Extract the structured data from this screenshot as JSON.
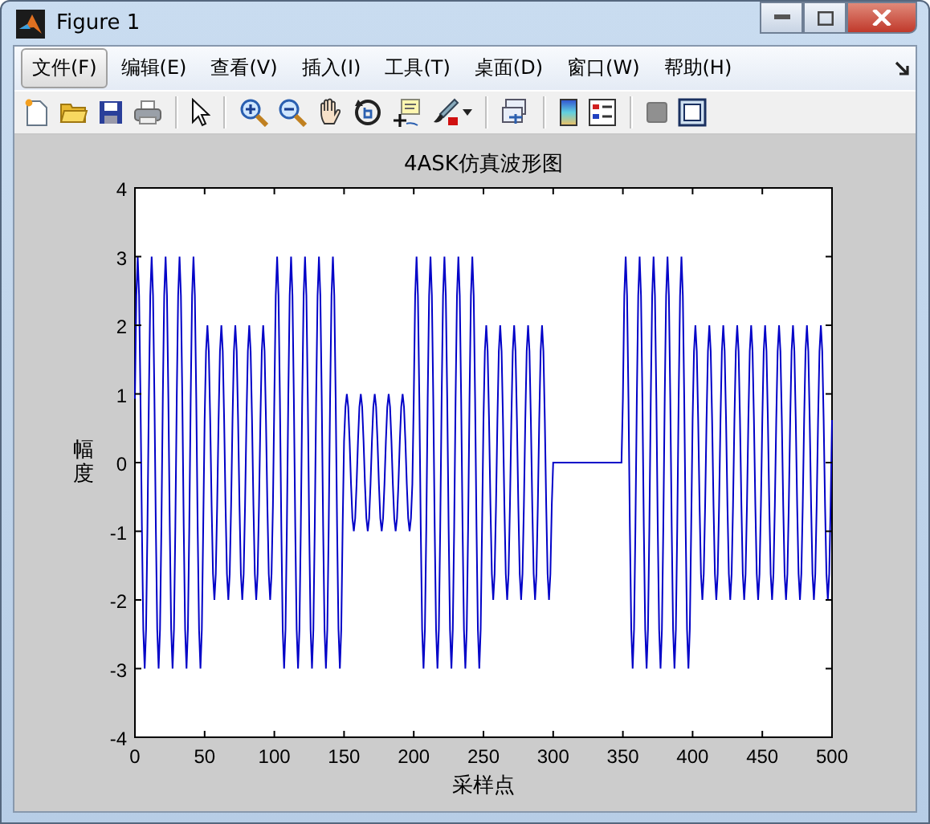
{
  "window": {
    "title": "Figure 1"
  },
  "menu": [
    {
      "label": "文件(F)",
      "selected": true
    },
    {
      "label": "编辑(E)",
      "selected": false
    },
    {
      "label": "查看(V)",
      "selected": false
    },
    {
      "label": "插入(I)",
      "selected": false
    },
    {
      "label": "工具(T)",
      "selected": false
    },
    {
      "label": "桌面(D)",
      "selected": false
    },
    {
      "label": "窗口(W)",
      "selected": false
    },
    {
      "label": "帮助(H)",
      "selected": false
    }
  ],
  "figure": {
    "chart_data": {
      "type": "line",
      "title": "4ASK仿真波形图",
      "xlabel": "采样点",
      "ylabel": "幅度",
      "xlim": [
        0,
        500
      ],
      "ylim": [
        -4,
        4
      ],
      "xticks": [
        0,
        50,
        100,
        150,
        200,
        250,
        300,
        350,
        400,
        450,
        500
      ],
      "yticks": [
        -4,
        -3,
        -2,
        -1,
        0,
        1,
        2,
        3,
        4
      ],
      "x": [
        0,
        1,
        2,
        3,
        4,
        5,
        6,
        7,
        8,
        9,
        10,
        11,
        12,
        13,
        14,
        15,
        16,
        17,
        18,
        19,
        20,
        21,
        22,
        23,
        24,
        25,
        26,
        27,
        28,
        29,
        30,
        31,
        32,
        33,
        34,
        35,
        36,
        37,
        38,
        39,
        40,
        41,
        42,
        43,
        44,
        45,
        46,
        47,
        48,
        49,
        50,
        51,
        52,
        53,
        54,
        55,
        56,
        57,
        58,
        59,
        60,
        61,
        62,
        63,
        64,
        65,
        66,
        67,
        68,
        69,
        70,
        71,
        72,
        73,
        74,
        75,
        76,
        77,
        78,
        79,
        80,
        81,
        82,
        83,
        84,
        85,
        86,
        87,
        88,
        89,
        90,
        91,
        92,
        93,
        94,
        95,
        96,
        97,
        98,
        99,
        100,
        101,
        102,
        103,
        104,
        105,
        106,
        107,
        108,
        109,
        110,
        111,
        112,
        113,
        114,
        115,
        116,
        117,
        118,
        119,
        120,
        121,
        122,
        123,
        124,
        125,
        126,
        127,
        128,
        129,
        130,
        131,
        132,
        133,
        134,
        135,
        136,
        137,
        138,
        139,
        140,
        141,
        142,
        143,
        144,
        145,
        146,
        147,
        148,
        149,
        150,
        151,
        152,
        153,
        154,
        155,
        156,
        157,
        158,
        159,
        160,
        161,
        162,
        163,
        164,
        165,
        166,
        167,
        168,
        169,
        170,
        171,
        172,
        173,
        174,
        175,
        176,
        177,
        178,
        179,
        180,
        181,
        182,
        183,
        184,
        185,
        186,
        187,
        188,
        189,
        190,
        191,
        192,
        193,
        194,
        195,
        196,
        197,
        198,
        199,
        200,
        201,
        202,
        203,
        204,
        205,
        206,
        207,
        208,
        209,
        210,
        211,
        212,
        213,
        214,
        215,
        216,
        217,
        218,
        219,
        220,
        221,
        222,
        223,
        224,
        225,
        226,
        227,
        228,
        229,
        230,
        231,
        232,
        233,
        234,
        235,
        236,
        237,
        238,
        239,
        240,
        241,
        242,
        243,
        244,
        245,
        246,
        247,
        248,
        249,
        250,
        251,
        252,
        253,
        254,
        255,
        256,
        257,
        258,
        259,
        260,
        261,
        262,
        263,
        264,
        265,
        266,
        267,
        268,
        269,
        270,
        271,
        272,
        273,
        274,
        275,
        276,
        277,
        278,
        279,
        280,
        281,
        282,
        283,
        284,
        285,
        286,
        287,
        288,
        289,
        290,
        291,
        292,
        293,
        294,
        295,
        296,
        297,
        298,
        299,
        300,
        301,
        302,
        303,
        304,
        305,
        306,
        307,
        308,
        309,
        310,
        311,
        312,
        313,
        314,
        315,
        316,
        317,
        318,
        319,
        320,
        321,
        322,
        323,
        324,
        325,
        326,
        327,
        328,
        329,
        330,
        331,
        332,
        333,
        334,
        335,
        336,
        337,
        338,
        339,
        340,
        341,
        342,
        343,
        344,
        345,
        346,
        347,
        348,
        349,
        350,
        351,
        352,
        353,
        354,
        355,
        356,
        357,
        358,
        359,
        360,
        361,
        362,
        363,
        364,
        365,
        366,
        367,
        368,
        369,
        370,
        371,
        372,
        373,
        374,
        375,
        376,
        377,
        378,
        379,
        380,
        381,
        382,
        383,
        384,
        385,
        386,
        387,
        388,
        389,
        390,
        391,
        392,
        393,
        394,
        395,
        396,
        397,
        398,
        399,
        400,
        401,
        402,
        403,
        404,
        405,
        406,
        407,
        408,
        409,
        410,
        411,
        412,
        413,
        414,
        415,
        416,
        417,
        418,
        419,
        420,
        421,
        422,
        423,
        424,
        425,
        426,
        427,
        428,
        429,
        430,
        431,
        432,
        433,
        434,
        435,
        436,
        437,
        438,
        439,
        440,
        441,
        442,
        443,
        444,
        445,
        446,
        447,
        448,
        449,
        450,
        451,
        452,
        453,
        454,
        455,
        456,
        457,
        458,
        459,
        460,
        461,
        462,
        463,
        464,
        465,
        466,
        467,
        468,
        469,
        470,
        471,
        472,
        473,
        474,
        475,
        476,
        477,
        478,
        479,
        480,
        481,
        482,
        483,
        484,
        485,
        486,
        487,
        488,
        489,
        490,
        491,
        492,
        493,
        494,
        495,
        496,
        497,
        498,
        499,
        500
      ],
      "series": [
        {
          "color": "#0000c8",
          "values": [
            0.93,
            2.43,
            3,
            2.43,
            0.93,
            -0.93,
            -2.43,
            -3,
            -2.43,
            -0.93,
            0.93,
            2.43,
            3,
            2.43,
            0.93,
            -0.93,
            -2.43,
            -3,
            -2.43,
            -0.93,
            0.93,
            2.43,
            3,
            2.43,
            0.93,
            -0.93,
            -2.43,
            -3,
            -2.43,
            -0.93,
            0.93,
            2.43,
            3,
            2.43,
            0.93,
            -0.93,
            -2.43,
            -3,
            -2.43,
            -0.93,
            0.93,
            2.43,
            3,
            2.43,
            0.93,
            -0.93,
            -2.43,
            -3,
            -2.43,
            -0.93,
            0.62,
            1.62,
            2,
            1.62,
            0.62,
            -0.62,
            -1.62,
            -2,
            -1.62,
            -0.62,
            0.62,
            1.62,
            2,
            1.62,
            0.62,
            -0.62,
            -1.62,
            -2,
            -1.62,
            -0.62,
            0.62,
            1.62,
            2,
            1.62,
            0.62,
            -0.62,
            -1.62,
            -2,
            -1.62,
            -0.62,
            0.62,
            1.62,
            2,
            1.62,
            0.62,
            -0.62,
            -1.62,
            -2,
            -1.62,
            -0.62,
            0.62,
            1.62,
            2,
            1.62,
            0.62,
            -0.62,
            -1.62,
            -2,
            -1.62,
            -0.62,
            0.93,
            2.43,
            3,
            2.43,
            0.93,
            -0.93,
            -2.43,
            -3,
            -2.43,
            -0.93,
            0.93,
            2.43,
            3,
            2.43,
            0.93,
            -0.93,
            -2.43,
            -3,
            -2.43,
            -0.93,
            0.93,
            2.43,
            3,
            2.43,
            0.93,
            -0.93,
            -2.43,
            -3,
            -2.43,
            -0.93,
            0.93,
            2.43,
            3,
            2.43,
            0.93,
            -0.93,
            -2.43,
            -3,
            -2.43,
            -0.93,
            0.93,
            2.43,
            3,
            2.43,
            0.93,
            -0.93,
            -2.43,
            -3,
            -2.43,
            -0.93,
            0.31,
            0.81,
            1,
            0.81,
            0.31,
            -0.31,
            -0.81,
            -1,
            -0.81,
            -0.31,
            0.31,
            0.81,
            1,
            0.81,
            0.31,
            -0.31,
            -0.81,
            -1,
            -0.81,
            -0.31,
            0.31,
            0.81,
            1,
            0.81,
            0.31,
            -0.31,
            -0.81,
            -1,
            -0.81,
            -0.31,
            0.31,
            0.81,
            1,
            0.81,
            0.31,
            -0.31,
            -0.81,
            -1,
            -0.81,
            -0.31,
            0.31,
            0.81,
            1,
            0.81,
            0.31,
            -0.31,
            -0.81,
            -1,
            -0.81,
            -0.31,
            0.93,
            2.43,
            3,
            2.43,
            0.93,
            -0.93,
            -2.43,
            -3,
            -2.43,
            -0.93,
            0.93,
            2.43,
            3,
            2.43,
            0.93,
            -0.93,
            -2.43,
            -3,
            -2.43,
            -0.93,
            0.93,
            2.43,
            3,
            2.43,
            0.93,
            -0.93,
            -2.43,
            -3,
            -2.43,
            -0.93,
            0.93,
            2.43,
            3,
            2.43,
            0.93,
            -0.93,
            -2.43,
            -3,
            -2.43,
            -0.93,
            0.93,
            2.43,
            3,
            2.43,
            0.93,
            -0.93,
            -2.43,
            -3,
            -2.43,
            -0.93,
            0.62,
            1.62,
            2,
            1.62,
            0.62,
            -0.62,
            -1.62,
            -2,
            -1.62,
            -0.62,
            0.62,
            1.62,
            2,
            1.62,
            0.62,
            -0.62,
            -1.62,
            -2,
            -1.62,
            -0.62,
            0.62,
            1.62,
            2,
            1.62,
            0.62,
            -0.62,
            -1.62,
            -2,
            -1.62,
            -0.62,
            0.62,
            1.62,
            2,
            1.62,
            0.62,
            -0.62,
            -1.62,
            -2,
            -1.62,
            -0.62,
            0.62,
            1.62,
            2,
            1.62,
            0.62,
            -0.62,
            -1.62,
            -2,
            -1.62,
            -0.62,
            0,
            0,
            0,
            0,
            0,
            0,
            0,
            0,
            0,
            0,
            0,
            0,
            0,
            0,
            0,
            0,
            0,
            0,
            0,
            0,
            0,
            0,
            0,
            0,
            0,
            0,
            0,
            0,
            0,
            0,
            0,
            0,
            0,
            0,
            0,
            0,
            0,
            0,
            0,
            0,
            0,
            0,
            0,
            0,
            0,
            0,
            0,
            0,
            0,
            0,
            0.93,
            2.43,
            3,
            2.43,
            0.93,
            -0.93,
            -2.43,
            -3,
            -2.43,
            -0.93,
            0.93,
            2.43,
            3,
            2.43,
            0.93,
            -0.93,
            -2.43,
            -3,
            -2.43,
            -0.93,
            0.93,
            2.43,
            3,
            2.43,
            0.93,
            -0.93,
            -2.43,
            -3,
            -2.43,
            -0.93,
            0.93,
            2.43,
            3,
            2.43,
            0.93,
            -0.93,
            -2.43,
            -3,
            -2.43,
            -0.93,
            0.93,
            2.43,
            3,
            2.43,
            0.93,
            -0.93,
            -2.43,
            -3,
            -2.43,
            -0.93,
            0.62,
            1.62,
            2,
            1.62,
            0.62,
            -0.62,
            -1.62,
            -2,
            -1.62,
            -0.62,
            0.62,
            1.62,
            2,
            1.62,
            0.62,
            -0.62,
            -1.62,
            -2,
            -1.62,
            -0.62,
            0.62,
            1.62,
            2,
            1.62,
            0.62,
            -0.62,
            -1.62,
            -2,
            -1.62,
            -0.62,
            0.62,
            1.62,
            2,
            1.62,
            0.62,
            -0.62,
            -1.62,
            -2,
            -1.62,
            -0.62,
            0.62,
            1.62,
            2,
            1.62,
            0.62,
            -0.62,
            -1.62,
            -2,
            -1.62,
            -0.62,
            0.62,
            1.62,
            2,
            1.62,
            0.62,
            -0.62,
            -1.62,
            -2,
            -1.62,
            -0.62,
            0.62,
            1.62,
            2,
            1.62,
            0.62,
            -0.62,
            -1.62,
            -2,
            -1.62,
            -0.62,
            0.62,
            1.62,
            2,
            1.62,
            0.62,
            -0.62,
            -1.62,
            -2,
            -1.62,
            -0.62,
            0.62,
            1.62,
            2,
            1.62,
            0.62,
            -0.62,
            -1.62,
            -2,
            -1.62,
            -0.62,
            0.62,
            1.62,
            2,
            1.62,
            0.62,
            -0.62,
            -1.62,
            -2,
            -1.62,
            -0.62,
            0.62
          ]
        }
      ]
    }
  }
}
